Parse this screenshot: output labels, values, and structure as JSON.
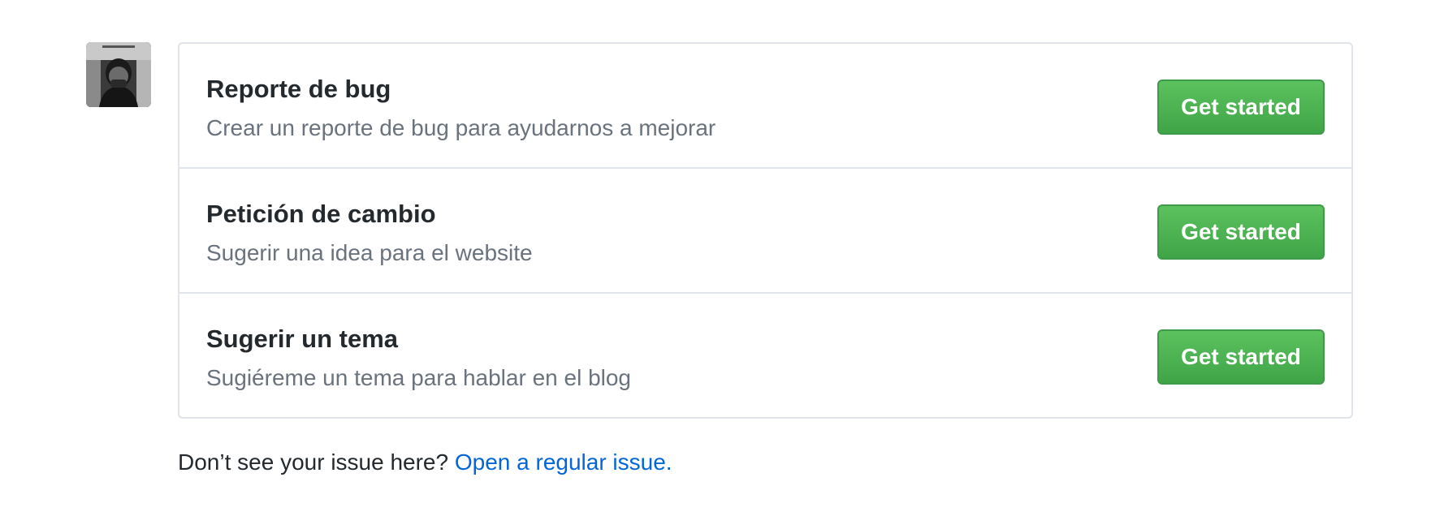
{
  "templates": [
    {
      "title": "Reporte de bug",
      "description": "Crear un reporte de bug para ayudarnos a mejorar",
      "button_label": "Get started"
    },
    {
      "title": "Petición de cambio",
      "description": "Sugerir una idea para el website",
      "button_label": "Get started"
    },
    {
      "title": "Sugerir un tema",
      "description": "Sugiéreme un tema para hablar en el blog",
      "button_label": "Get started"
    }
  ],
  "footer": {
    "prompt": "Don’t see your issue here? ",
    "link_label": "Open a regular issue."
  },
  "colors": {
    "button_green": "#4cb050",
    "link_blue": "#0366d6",
    "muted_text": "#6a737d",
    "border": "#e1e4e8"
  }
}
